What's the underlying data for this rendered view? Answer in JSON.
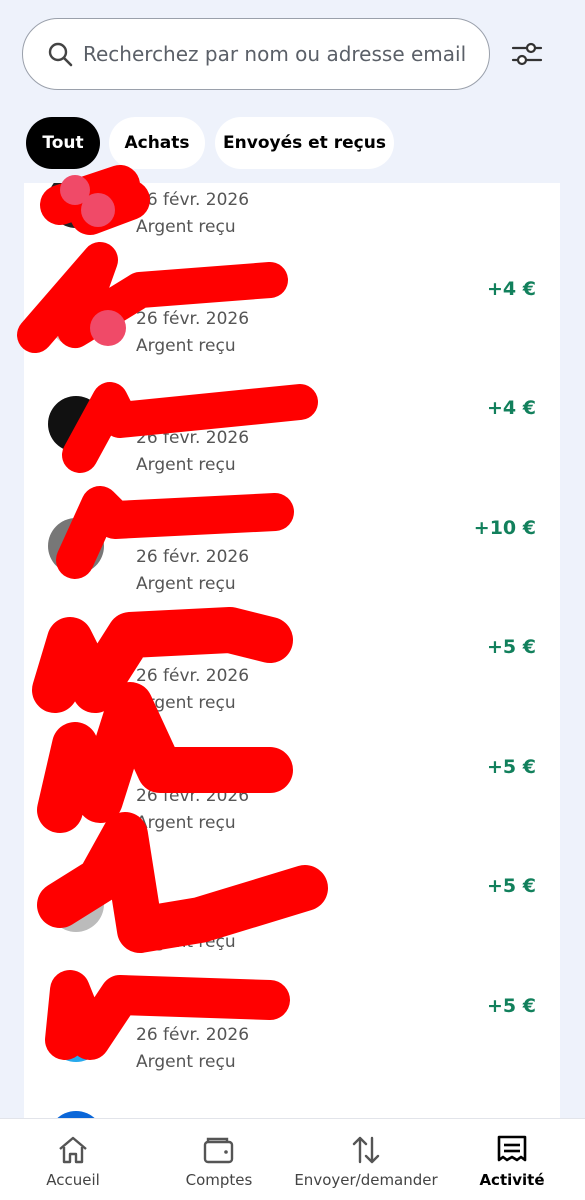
{
  "search": {
    "placeholder": "Recherchez par nom ou adresse email"
  },
  "filters": [
    {
      "label": "Tout",
      "active": true
    },
    {
      "label": "Achats",
      "active": false
    },
    {
      "label": "Envoyés et reçus",
      "active": false
    }
  ],
  "transactions": [
    {
      "name": "",
      "date": "26 févr. 2026",
      "type": "Argent reçu",
      "amount": ""
    },
    {
      "name": "",
      "date": "26 févr. 2026",
      "type": "Argent reçu",
      "amount": "+4 €"
    },
    {
      "name": "",
      "date": "26 févr. 2026",
      "type": "Argent reçu",
      "amount": "+4 €"
    },
    {
      "name": "",
      "date": "26 févr. 2026",
      "type": "Argent reçu",
      "amount": "+10 €"
    },
    {
      "name": "",
      "date": "26 févr. 2026",
      "type": "Argent reçu",
      "amount": "+5 €"
    },
    {
      "name": "",
      "date": "26 févr. 2026",
      "type": "Argent reçu",
      "amount": "+5 €"
    },
    {
      "name": "",
      "date": "26 févr. 2026",
      "type": "Argent reçu",
      "amount": "+5 €"
    },
    {
      "name": "",
      "date": "26 févr. 2026",
      "type": "Argent reçu",
      "amount": "+5 €"
    }
  ],
  "nav": [
    {
      "label": "Accueil",
      "icon": "home-icon",
      "active": false
    },
    {
      "label": "Comptes",
      "icon": "wallet-icon",
      "active": false
    },
    {
      "label": "Envoyer/demander",
      "icon": "transfer-icon",
      "active": false
    },
    {
      "label": "Activité",
      "icon": "activity-icon",
      "active": true
    }
  ],
  "colors": {
    "background": "#eef2fb",
    "positive_amount": "#12805c",
    "active_chip": "#000000",
    "redaction": "#ff0000"
  }
}
